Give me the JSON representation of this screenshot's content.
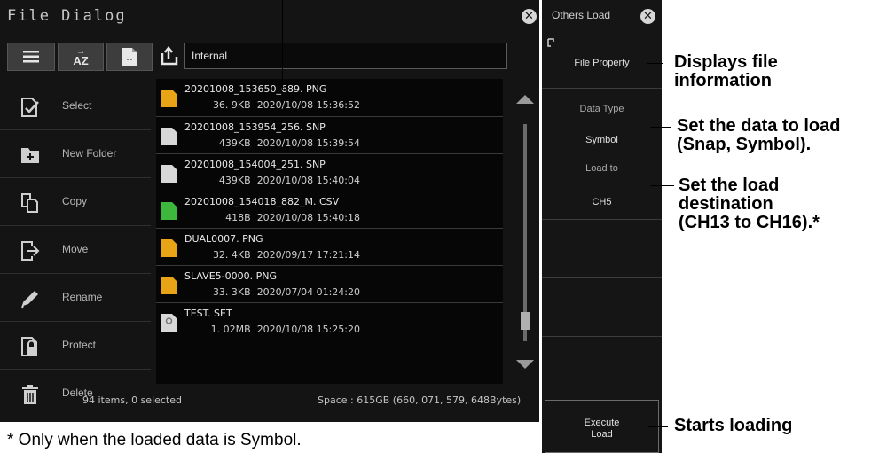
{
  "file_dialog": {
    "title": "File Dialog",
    "path": "Internal",
    "toolbar": {
      "sort_label": "AZ"
    },
    "sidebar": [
      {
        "label": "Select",
        "icon": "select-icon"
      },
      {
        "label": "New Folder",
        "icon": "new-folder-icon"
      },
      {
        "label": "Copy",
        "icon": "copy-icon"
      },
      {
        "label": "Move",
        "icon": "move-icon"
      },
      {
        "label": "Rename",
        "icon": "rename-icon"
      },
      {
        "label": "Protect",
        "icon": "protect-icon"
      },
      {
        "label": "Delete",
        "icon": "delete-icon"
      }
    ],
    "files": [
      {
        "name": "20201008_153650_689. PNG",
        "size": "36. 9KB",
        "date": "2020/10/08 15:36:52",
        "type": "PNG",
        "color": "#e8a317"
      },
      {
        "name": "20201008_153954_256. SNP",
        "size": "439KB",
        "date": "2020/10/08 15:39:54",
        "type": "SNP",
        "color": "#d8d8d8"
      },
      {
        "name": "20201008_154004_251. SNP",
        "size": "439KB",
        "date": "2020/10/08 15:40:04",
        "type": "SNP",
        "color": "#d8d8d8"
      },
      {
        "name": "20201008_154018_882_M. CSV",
        "size": "418B",
        "date": "2020/10/08 15:40:18",
        "type": "CSV",
        "color": "#3db83d"
      },
      {
        "name": "DUAL0007. PNG",
        "size": "32. 4KB",
        "date": "2020/09/17 17:21:14",
        "type": "PNG",
        "color": "#e8a317"
      },
      {
        "name": "SLAVE5-0000. PNG",
        "size": "33. 3KB",
        "date": "2020/07/04 01:24:20",
        "type": "PNG",
        "color": "#e8a317"
      },
      {
        "name": "TEST. SET",
        "size": "1. 02MB",
        "date": "2020/10/08 15:25:20",
        "type": "SET",
        "color": "#d8d8d8"
      }
    ],
    "status": {
      "items": "94 items, 0 selected",
      "space": "Space : 615GB (660, 071, 579, 648Bytes)"
    },
    "scroll": {
      "position": 0.85
    }
  },
  "others_load": {
    "title": "Others Load",
    "file_property_label": "File Property",
    "data_type_label": "Data Type",
    "data_type_value": "Symbol",
    "load_to_label": "Load to",
    "load_to_value": "CH5",
    "execute_line1": "Execute",
    "execute_line2": "Load"
  },
  "callouts": {
    "file_property": [
      "Displays file",
      "information"
    ],
    "data_type": [
      "Set the data to load",
      "(Snap, Symbol)."
    ],
    "load_to": [
      "Set the load",
      "destination",
      "(CH13 to CH16).*"
    ],
    "execute": "Starts loading"
  },
  "footnote": "* Only when the loaded data is Symbol."
}
